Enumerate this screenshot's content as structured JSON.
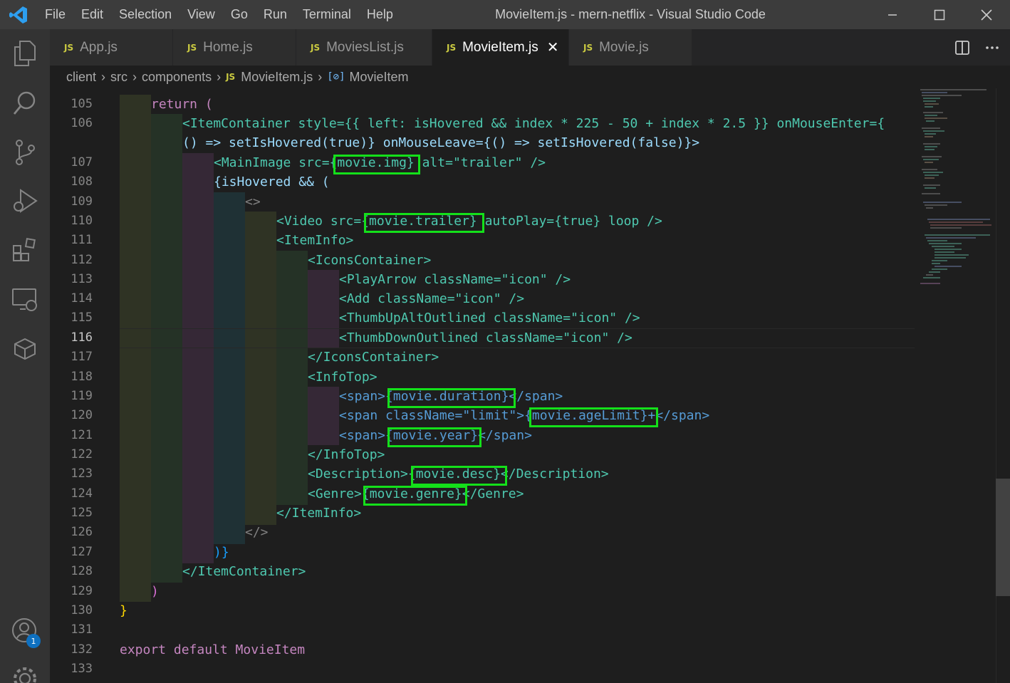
{
  "window": {
    "title": "MovieItem.js - mern-netflix - Visual Studio Code",
    "menu": [
      "File",
      "Edit",
      "Selection",
      "View",
      "Go",
      "Run",
      "Terminal",
      "Help"
    ]
  },
  "activity_bar": {
    "icons": [
      "explorer-icon",
      "search-icon",
      "source-control-icon",
      "run-debug-icon",
      "extensions-icon",
      "remote-explorer-icon",
      "docker-icon",
      "accounts-icon",
      "manage-gear-icon"
    ],
    "accounts_badge": "1"
  },
  "tabs": [
    {
      "label": "App.js",
      "active": false
    },
    {
      "label": "Home.js",
      "active": false
    },
    {
      "label": "MoviesList.js",
      "active": false
    },
    {
      "label": "MovieItem.js",
      "active": true
    },
    {
      "label": "Movie.js",
      "active": false
    }
  ],
  "tab_badge": "JS",
  "breadcrumb": {
    "segments": [
      "client",
      "src",
      "components",
      "MovieItem.js",
      "MovieItem"
    ]
  },
  "editor": {
    "current_line": "116",
    "line_numbers": [
      "105",
      "106",
      "",
      "107",
      "108",
      "109",
      "110",
      "111",
      "112",
      "113",
      "114",
      "115",
      "116",
      "117",
      "118",
      "119",
      "120",
      "121",
      "122",
      "123",
      "124",
      "125",
      "126",
      "127",
      "128",
      "129",
      "130",
      "131",
      "132",
      "133"
    ],
    "lines": [
      "return (",
      "<ItemContainer style={{ left: isHovered && index * 225 - 50 + index * 2.5 }} onMouseEnter={",
      "() => setIsHovered(true)} onMouseLeave={() => setIsHovered(false)}>",
      "<MainImage src={movie.img} alt=\"trailer\" />",
      "{isHovered && (",
      "<>",
      "<Video src={movie.trailer} autoPlay={true} loop />",
      "<ItemInfo>",
      "<IconsContainer>",
      "<PlayArrow className=\"icon\" />",
      "<Add className=\"icon\" />",
      "<ThumbUpAltOutlined className=\"icon\" />",
      "<ThumbDownOutlined className=\"icon\" />",
      "</IconsContainer>",
      "<InfoTop>",
      "<span>{movie.duration}</span>",
      "<span className=\"limit\">{movie.ageLimit}+</span>",
      "<span>{movie.year}</span>",
      "</InfoTop>",
      "<Description>{movie.desc}</Description>",
      "<Genre>{movie.genre}</Genre>",
      "</ItemInfo>",
      "</>",
      ")}",
      "</ItemContainer>",
      ")",
      "}",
      "",
      "export default MovieItem",
      ""
    ]
  },
  "colors": {
    "highlight_box": "#14e01a",
    "title_bar": "#3c3c3c",
    "activity_bar": "#333333",
    "editor_bg": "#1e1e1e"
  }
}
